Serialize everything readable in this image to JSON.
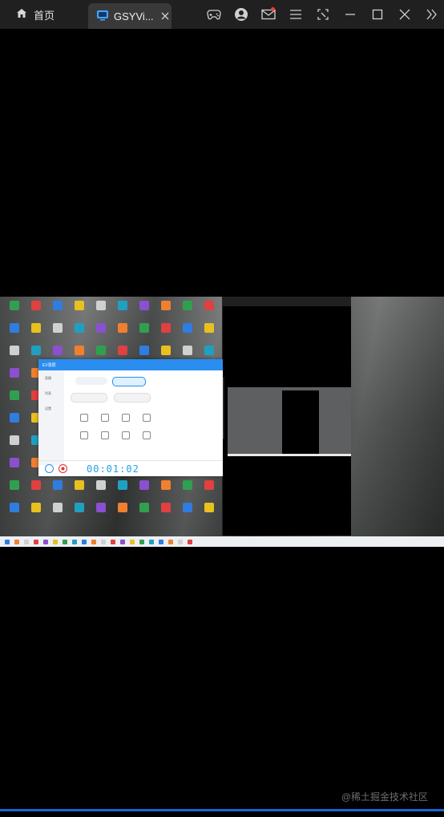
{
  "titlebar": {
    "home_tab_label": "首页",
    "active_tab_label": "GSYVi...",
    "icons": [
      "home-icon",
      "player-icon",
      "close-icon",
      "gamepad-icon",
      "avatar-icon",
      "mail-icon",
      "menu-icon",
      "screenshot-icon",
      "minimize-icon",
      "maximize-icon",
      "close-window-icon",
      "more-icon"
    ]
  },
  "recorder": {
    "title": "EV录屏",
    "sidebar_items": [
      "直播",
      "列表",
      "设置"
    ],
    "timer": "00:01:02"
  },
  "watermark": "@稀土掘金技术社区",
  "playback": {
    "progress": 1.0
  },
  "colors": {
    "titlebar_bg": "#202020",
    "active_tab_bg": "#393939",
    "recorder_accent": "#2a8df0",
    "timer_color": "#1ea0e6",
    "progress_color": "#1766d6"
  }
}
